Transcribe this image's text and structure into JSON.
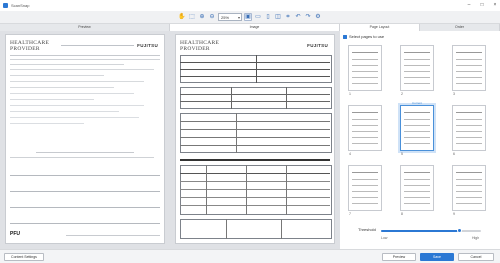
{
  "window": {
    "title": "ScanSnap"
  },
  "toolbar": {
    "zoom_value": "25%"
  },
  "columns": {
    "left": "Preview",
    "center": "Image",
    "right_a": "Page Layout",
    "right_b": "Order"
  },
  "document": {
    "brand_line1": "HEALTHCARE",
    "brand_line2": "PROVIDER",
    "fujitsu": "FUJITSU",
    "pfu": "PFU"
  },
  "right_panel": {
    "select_all_label": "Select pages to use",
    "thumbs": [
      {
        "label": "1"
      },
      {
        "label": "2"
      },
      {
        "label": "3"
      },
      {
        "label": "4",
        "caption": "Current"
      },
      {
        "label": "5"
      },
      {
        "label": "6"
      },
      {
        "label": "7"
      },
      {
        "label": "8"
      },
      {
        "label": "9"
      }
    ],
    "slider_label": "Threshold",
    "slider_min": "Low",
    "slider_max": "High",
    "slider_value": 0.78
  },
  "footer": {
    "left_button": "Content Settings",
    "preview_button": "Preview",
    "ok_button": "Save",
    "cancel_button": "Cancel"
  },
  "colors": {
    "accent": "#2b78d4",
    "selected_border": "#4a90d9"
  }
}
